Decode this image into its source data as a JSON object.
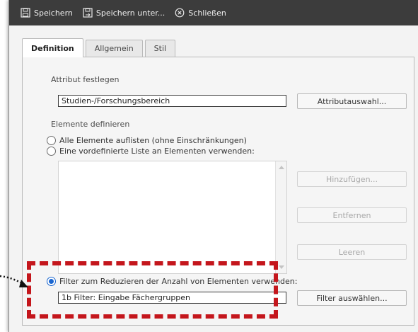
{
  "toolbar": {
    "save_label": "Speichern",
    "save_as_label": "Speichern unter...",
    "close_label": "Schließen",
    "save_icon": "save-icon",
    "save_as_icon": "save-as-icon",
    "close_icon": "close-circle-icon"
  },
  "tabs": [
    {
      "label": "Definition",
      "active": true
    },
    {
      "label": "Allgemein",
      "active": false
    },
    {
      "label": "Stil",
      "active": false
    }
  ],
  "attribute": {
    "section_label": "Attribut festlegen",
    "value": "Studien-/Forschungsbereich",
    "select_button": "Attributauswahl..."
  },
  "elements": {
    "section_label": "Elemente definieren",
    "options": [
      {
        "label": "Alle Elemente auflisten (ohne Einschränkungen)",
        "checked": false
      },
      {
        "label": "Eine vordefinierte Liste an Elementen verwenden:",
        "checked": false
      },
      {
        "label": "Filter zum Reduzieren der Anzahl von Elementen verwenden:",
        "checked": true
      }
    ],
    "list_buttons": {
      "add": "Hinzufügen...",
      "remove": "Entfernen",
      "clear": "Leeren"
    }
  },
  "filter": {
    "value": "1b Filter: Eingabe Fächergruppen",
    "select_button": "Filter auswählen..."
  },
  "colors": {
    "highlight": "#c4161c",
    "radio_accent": "#1a66d0",
    "toolbar_bg": "#3c3c3c"
  }
}
